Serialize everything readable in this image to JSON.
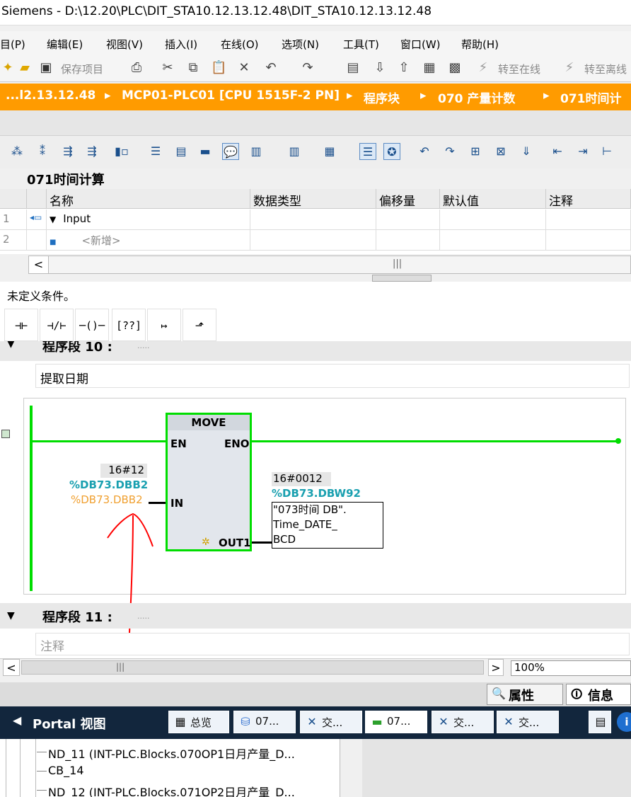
{
  "window": {
    "title": "Siemens  -  D:\\12.20\\PLC\\DIT_STA10.12.13.12.48\\DIT_STA10.12.13.12.48"
  },
  "menu": [
    "目(P)",
    "编辑(E)",
    "视图(V)",
    "插入(I)",
    "在线(O)",
    "选项(N)",
    "工具(T)",
    "窗口(W)",
    "帮助(H)"
  ],
  "toolbar": {
    "save_label": "保存项目",
    "go_online_label": "转至在线",
    "go_offline_label": "转至离线"
  },
  "breadcrumb": {
    "items": [
      "...l2.13.12.48",
      "MCP01-PLC01 [CPU 1515F-2 PN]",
      "程序块",
      "070 产量计数",
      "071时间计"
    ],
    "separator": "▸"
  },
  "block": {
    "title": "071时间计算"
  },
  "interface_table": {
    "columns": [
      "名称",
      "数据类型",
      "偏移量",
      "默认值",
      "注释"
    ],
    "rows": [
      {
        "num": "1",
        "name": "Input"
      },
      {
        "num": "2",
        "name": "<新增>"
      }
    ]
  },
  "status": {
    "message": "未定义条件。"
  },
  "ladder_tools": [
    "⊣⊢",
    "⊣/⊢",
    "─()─",
    "[??]",
    "↦",
    "⬏"
  ],
  "network10": {
    "title": "程序段 10 :",
    "dots": ".....",
    "comment": "提取日期",
    "move_box": {
      "title": "MOVE",
      "en": "EN",
      "eno": "ENO",
      "in": "IN",
      "out": "OUT1"
    },
    "in_operand": {
      "value": "16#12",
      "address": "%DB73.DBB2",
      "address2": "%DB73.DBB2"
    },
    "out_operand": {
      "value": "16#0012",
      "address": "%DB73.DBW92",
      "symbol_line1": "\"073时间 DB\".",
      "symbol_line2": "Time_DATE_",
      "symbol_line3": "BCD"
    }
  },
  "network11": {
    "title": "程序段 11 :",
    "dots": ".....",
    "comment": "注释"
  },
  "zoom": {
    "value": "100%"
  },
  "bottom_tabs": {
    "properties": "属性",
    "info": "信息"
  },
  "taskbar": {
    "portal_label": "Portal 视图",
    "buttons": [
      "总览",
      "07...",
      "交...",
      "07...",
      "交...",
      "交..."
    ]
  },
  "tree": {
    "items": [
      "ND_11 (INT-PLC.Blocks.070OP1日月产量_D...",
      "CB_14",
      "ND_12 (INT-PLC.Blocks.071OP2日月产量_D..."
    ]
  },
  "colors": {
    "accent_orange": "#ff9b00",
    "rail_green": "#00dd00",
    "address_teal": "#1aa0b0",
    "address_orange": "#f0a030",
    "taskbar_navy": "#12263d",
    "annotation_red": "#ff0000"
  }
}
